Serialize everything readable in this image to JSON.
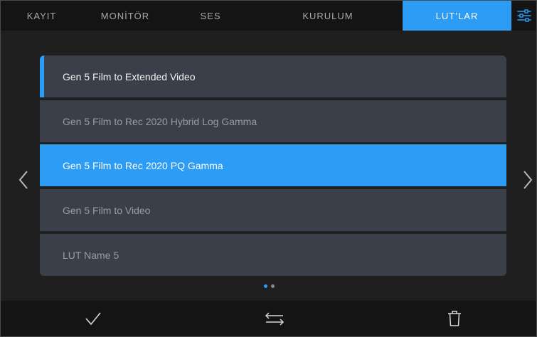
{
  "tabs": [
    {
      "label": "KAYIT"
    },
    {
      "label": "MONİTÖR"
    },
    {
      "label": "SES"
    },
    {
      "label": "KURULUM"
    },
    {
      "label": "LUT’LAR"
    }
  ],
  "active_tab": "LUT’LAR",
  "lut_list": {
    "items": [
      {
        "label": "Gen 5 Film to Extended Video",
        "state": "current"
      },
      {
        "label": "Gen 5 Film to Rec 2020 Hybrid Log Gamma",
        "state": "normal"
      },
      {
        "label": "Gen 5 Film to Rec 2020 PQ Gamma",
        "state": "selected"
      },
      {
        "label": "Gen 5 Film to Video",
        "state": "normal"
      },
      {
        "label": "LUT Name 5",
        "state": "normal"
      }
    ]
  },
  "pagination": {
    "current_page": 1,
    "total_pages": 2
  },
  "colors": {
    "accent": "#2c9cf4",
    "row_bg": "#3a3f49",
    "bar_bg": "#141414",
    "screen_bg": "#1f1f1f"
  },
  "icons": {
    "settings": "sliders-icon",
    "prev": "chevron-left-icon",
    "next": "chevron-right-icon",
    "apply": "checkmark-icon",
    "transfer": "swap-arrows-icon",
    "delete": "trash-icon"
  }
}
